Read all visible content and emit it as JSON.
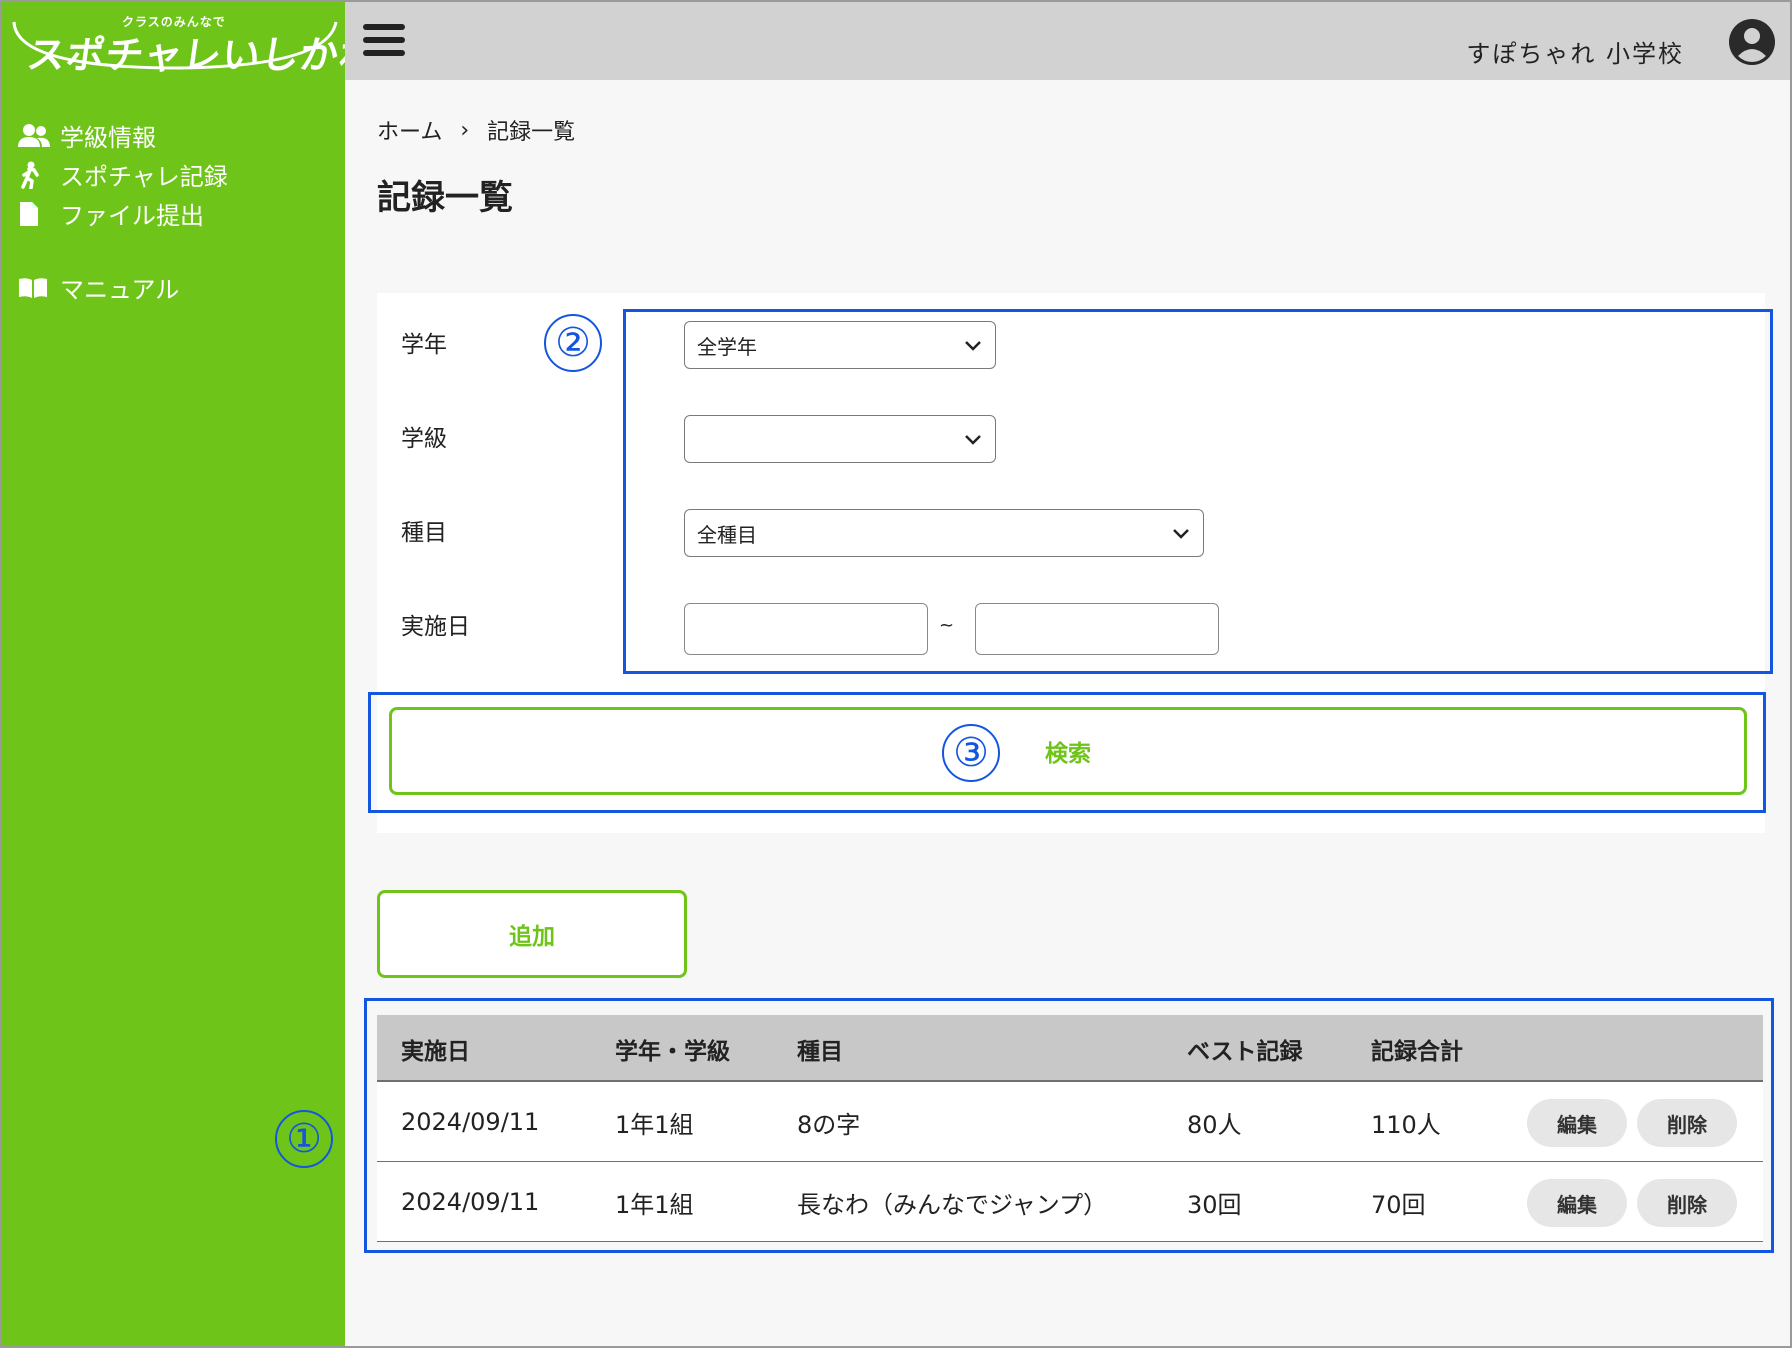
{
  "sidebar": {
    "logo": {
      "tagline": "クラスのみんなで",
      "name": "スポチャレいしかわ"
    },
    "items": [
      {
        "label": "学級情報",
        "icon": "users-icon"
      },
      {
        "label": "スポチャレ記録",
        "icon": "running-icon"
      },
      {
        "label": "ファイル提出",
        "icon": "file-icon"
      }
    ],
    "manual": {
      "label": "マニュアル",
      "icon": "book-icon"
    }
  },
  "header": {
    "school_name": "すぽちゃれ 小学校",
    "icon": "account-icon",
    "menu_icon": "hamburger-icon"
  },
  "breadcrumb": {
    "home": "ホーム",
    "current": "記録一覧"
  },
  "page_title": "記録一覧",
  "filter": {
    "grade_label": "学年",
    "grade_value": "全学年",
    "class_label": "学級",
    "class_value": "",
    "event_label": "種目",
    "event_value": "全種目",
    "date_label": "実施日",
    "date_from": "",
    "date_to": "",
    "date_separator": "~",
    "search_label": "検索"
  },
  "add_label": "追加",
  "table": {
    "columns": [
      "実施日",
      "学年・学級",
      "種目",
      "ベスト記録",
      "記録合計"
    ],
    "rows": [
      {
        "date": "2024/09/11",
        "class": "1年1組",
        "event": "8の字",
        "best": "80人",
        "total": "110人"
      },
      {
        "date": "2024/09/11",
        "class": "1年1組",
        "event": "長なわ（みんなでジャンプ）",
        "best": "30回",
        "total": "70回"
      }
    ],
    "edit_label": "編集",
    "delete_label": "削除"
  },
  "annotations": {
    "one": "①",
    "two": "②",
    "three": "③"
  },
  "colors": {
    "brand_green": "#6ec418",
    "annotation_blue": "#1456e0",
    "header_gray": "#d2d2d2"
  }
}
